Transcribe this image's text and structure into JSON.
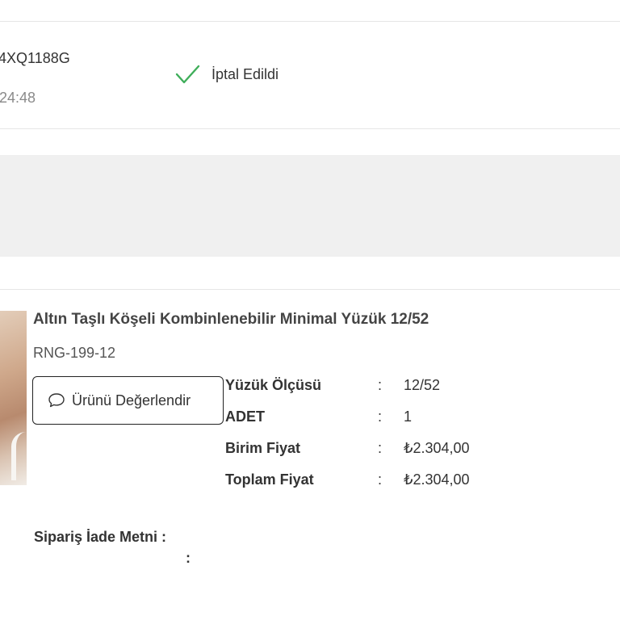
{
  "order": {
    "code": "4XQ1188G",
    "time": "24:48"
  },
  "status": {
    "text": "İptal Edildi",
    "icon": "check-icon",
    "color": "#3fae5a"
  },
  "product": {
    "name": "Altın Taşlı Köşeli Kombinlenebilir Minimal Yüzük 12/52",
    "sku": "RNG-199-12",
    "review_button": "Ürünü Değerlendir",
    "review_icon": "speech-bubble-icon"
  },
  "details": [
    {
      "label": "Yüzük Ölçüsü",
      "colon": ":",
      "value": "12/52"
    },
    {
      "label": "ADET",
      "colon": ":",
      "value": "1"
    },
    {
      "label": "Birim Fiyat",
      "colon": ":",
      "value": "₺2.304,00"
    },
    {
      "label": "Toplam Fiyat",
      "colon": ":",
      "value": "₺2.304,00"
    }
  ],
  "return": {
    "label": "Sipariş İade Metni :",
    "colon": ":"
  }
}
